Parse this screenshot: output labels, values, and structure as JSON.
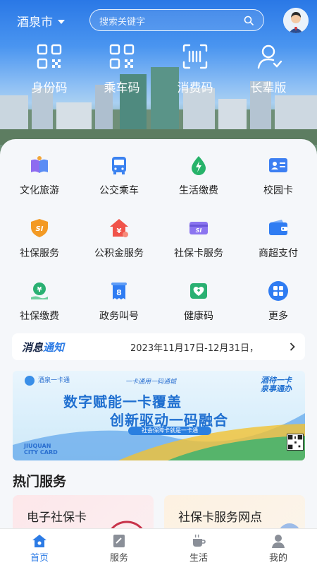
{
  "header": {
    "city": "酒泉市",
    "search_placeholder": "搜索关键字"
  },
  "quick_codes": [
    {
      "label": "身份码",
      "icon": "qr-code-icon"
    },
    {
      "label": "乘车码",
      "icon": "qr-code-icon"
    },
    {
      "label": "消费码",
      "icon": "scan-icon"
    },
    {
      "label": "长辈版",
      "icon": "elder-user-icon"
    }
  ],
  "services": [
    {
      "label": "文化旅游",
      "icon": "book-icon"
    },
    {
      "label": "公交乘车",
      "icon": "bus-icon"
    },
    {
      "label": "生活缴费",
      "icon": "water-drop-icon"
    },
    {
      "label": "校园卡",
      "icon": "id-card-icon"
    },
    {
      "label": "社保服务",
      "icon": "shield-icon"
    },
    {
      "label": "公积金服务",
      "icon": "house-fund-icon"
    },
    {
      "label": "社保卡服务",
      "icon": "si-card-icon"
    },
    {
      "label": "商超支付",
      "icon": "wallet-icon"
    },
    {
      "label": "社保缴费",
      "icon": "yuan-hand-icon"
    },
    {
      "label": "政务叫号",
      "icon": "queue-number-icon"
    },
    {
      "label": "健康码",
      "icon": "health-code-icon"
    },
    {
      "label": "更多",
      "icon": "more-grid-icon"
    }
  ],
  "notice": {
    "tag_part1": "消息",
    "tag_part2": "通知",
    "text": "2023年11月17日-12月31日，"
  },
  "banner": {
    "logo": "酒泉一卡通",
    "small_title": "一卡通用一码通城",
    "line1": "数字赋能一卡覆盖",
    "line2": "创新驱动一码融合",
    "pill": "社会保障卡就是一卡通",
    "slogan_1": "酒待一卡",
    "slogan_2": "泉事通办",
    "brand_1": "JIUQUAN",
    "brand_2": "CITY CARD"
  },
  "hot_services": {
    "title": "热门服务",
    "cards": [
      {
        "label": "电子社保卡"
      },
      {
        "label": "社保卡服务网点"
      }
    ]
  },
  "bottom_nav": [
    {
      "label": "首页",
      "icon": "home-icon",
      "active": true
    },
    {
      "label": "服务",
      "icon": "service-icon",
      "active": false
    },
    {
      "label": "生活",
      "icon": "cup-icon",
      "active": false
    },
    {
      "label": "我的",
      "icon": "user-icon",
      "active": false
    }
  ],
  "colors": {
    "primary": "#2c7be5",
    "hero_top": "#2a78e6"
  }
}
